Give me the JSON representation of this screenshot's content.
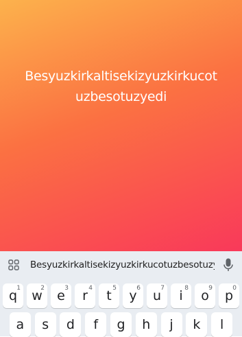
{
  "story": {
    "text_line1": "Besyuzkirkaltisekizyuzkirkucot",
    "text_line2": "uzbesotuzyedi",
    "gradient": [
      "#fcb24c",
      "#fb7142",
      "#f9395a"
    ]
  },
  "keyboard": {
    "suggestion": "Besyuzkirkaltisekizyuzkirkucotuzbesotuzyedi",
    "apps_icon": "grid-icon",
    "mic_icon": "microphone-icon",
    "row1": [
      {
        "key": "q",
        "hint": "1"
      },
      {
        "key": "w",
        "hint": "2"
      },
      {
        "key": "e",
        "hint": "3"
      },
      {
        "key": "r",
        "hint": "4"
      },
      {
        "key": "t",
        "hint": "5"
      },
      {
        "key": "y",
        "hint": "6"
      },
      {
        "key": "u",
        "hint": "7"
      },
      {
        "key": "i",
        "hint": "8"
      },
      {
        "key": "o",
        "hint": "9"
      },
      {
        "key": "p",
        "hint": "0"
      }
    ],
    "row2": [
      "a",
      "s",
      "d",
      "f",
      "g",
      "h",
      "j",
      "k",
      "l"
    ]
  }
}
